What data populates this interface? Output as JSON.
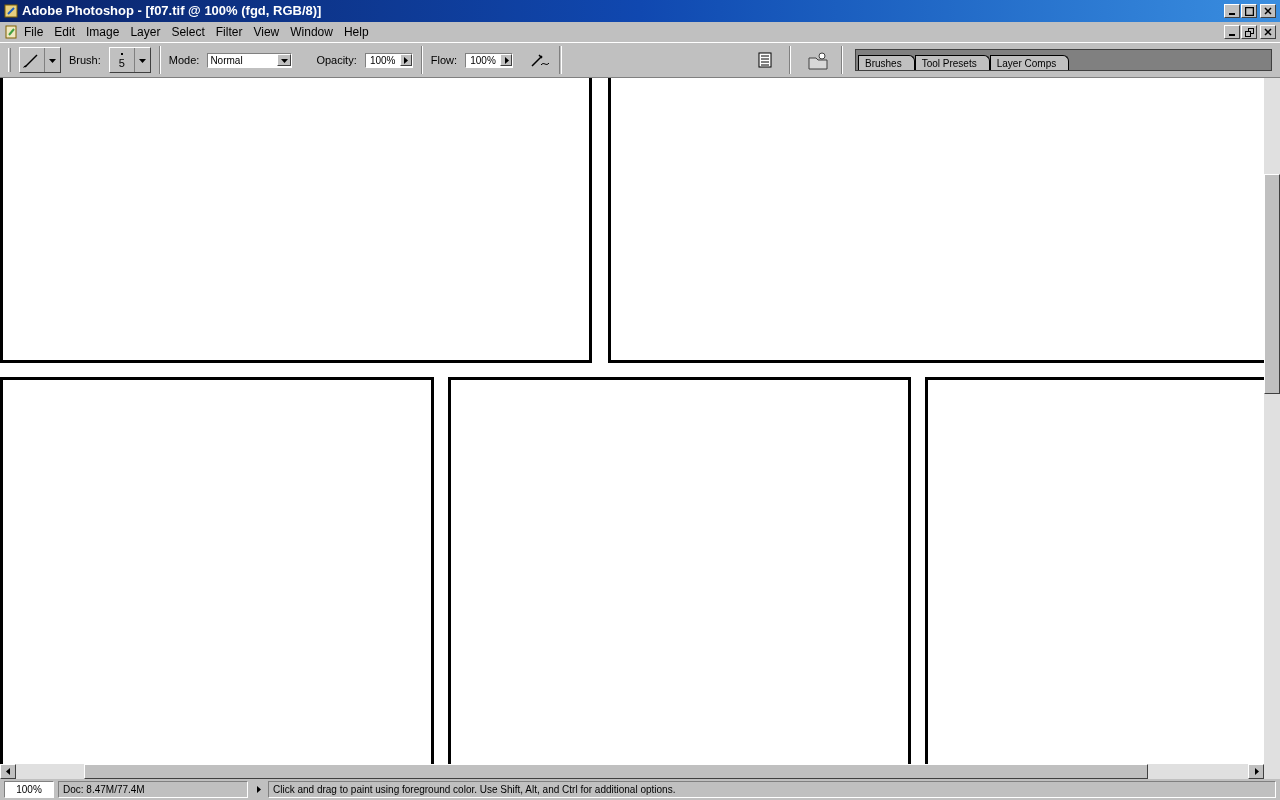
{
  "window": {
    "title": "Adobe Photoshop - [f07.tif @ 100% (fgd, RGB/8)]"
  },
  "menu": [
    "File",
    "Edit",
    "Image",
    "Layer",
    "Select",
    "Filter",
    "View",
    "Window",
    "Help"
  ],
  "options_bar": {
    "brush_label": "Brush:",
    "brush_size": "5",
    "mode_label": "Mode:",
    "mode_value": "Normal",
    "opacity_label": "Opacity:",
    "opacity_value": "100%",
    "flow_label": "Flow:",
    "flow_value": "100%"
  },
  "panel_tabs": [
    "Brushes",
    "Tool Presets",
    "Layer Comps"
  ],
  "status_bar": {
    "zoom": "100%",
    "doc_info": "Doc: 8.47M/77.4M",
    "hint": "Click and drag to paint using foreground color.  Use Shift, Alt, and Ctrl for additional options."
  }
}
